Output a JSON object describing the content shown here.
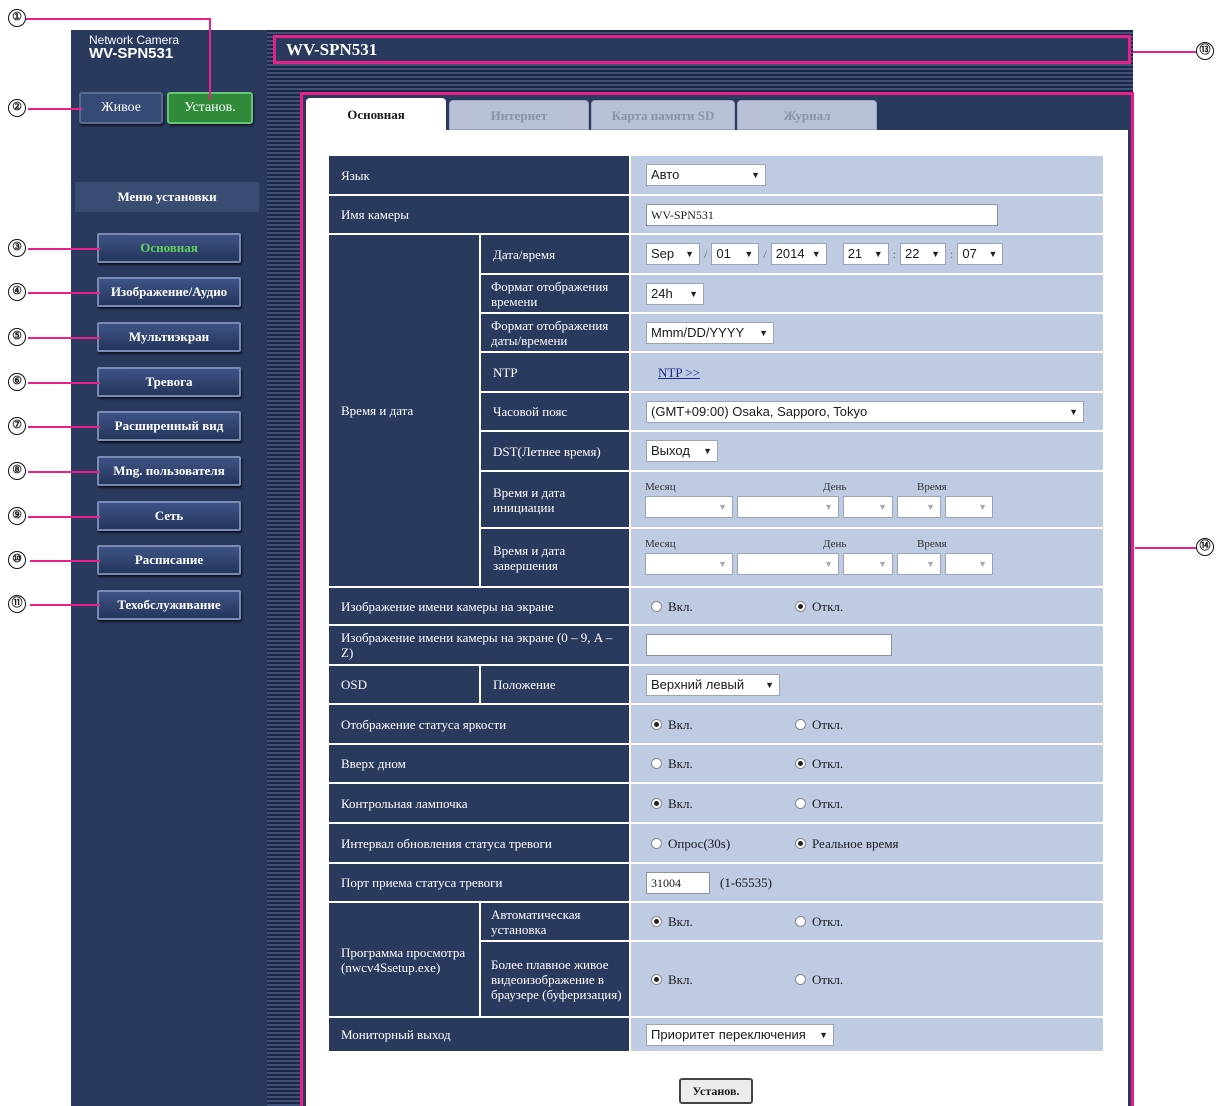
{
  "header": {
    "camera_label": "Network Camera",
    "camera_model": "WV-SPN531",
    "title": "WV-SPN531"
  },
  "top_buttons": {
    "live": "Живое",
    "setup": "Установ."
  },
  "menu": {
    "title": "Меню установки",
    "items": [
      "Основная",
      "Изображение/Аудио",
      "Мультиэкран",
      "Тревога",
      "Расширенный вид",
      "Mng. пользователя",
      "Сеть",
      "Расписание",
      "Техобслуживание"
    ]
  },
  "tabs": [
    "Основная",
    "Интернет",
    "Карта памяти SD",
    "Журнал"
  ],
  "form": {
    "language": {
      "label": "Язык",
      "value": "Авто"
    },
    "camera_name": {
      "label": "Имя камеры",
      "value": "WV-SPN531"
    },
    "time_date": {
      "group_label": "Время и дата",
      "datetime": {
        "label": "Дата/время",
        "month": "Sep",
        "day": "01",
        "year": "2014",
        "hour": "21",
        "minute": "22",
        "second": "07"
      },
      "time_format": {
        "label": "Формат отображения времени",
        "value": "24h"
      },
      "date_format": {
        "label": "Формат отображения даты/времени",
        "value": "Mmm/DD/YYYY"
      },
      "ntp": {
        "label": "NTP",
        "link": "NTP >>"
      },
      "timezone": {
        "label": "Часовой пояс",
        "value": "(GMT+09:00) Osaka, Sapporo, Tokyo"
      },
      "dst": {
        "label": "DST(Летнее время)",
        "value": "Выход"
      },
      "start": {
        "label": "Время и дата инициации"
      },
      "end": {
        "label": "Время и дата завершения"
      },
      "col_month": "Месяц",
      "col_day": "День",
      "col_time": "Время"
    },
    "camera_title_display": {
      "label": "Изображение имени камеры на экране",
      "on": "Вкл.",
      "off": "Откл."
    },
    "camera_title_text": {
      "label": "Изображение имени камеры на экране (0 – 9, A – Z)",
      "value": ""
    },
    "osd": {
      "label": "OSD",
      "sub_label": "Положение",
      "value": "Верхний левый"
    },
    "brightness_status": {
      "label": "Отображение статуса яркости",
      "on": "Вкл.",
      "off": "Откл."
    },
    "upside_down": {
      "label": "Вверх дном",
      "on": "Вкл.",
      "off": "Откл."
    },
    "indicator": {
      "label": "Контрольная лампочка",
      "on": "Вкл.",
      "off": "Откл."
    },
    "alarm_interval": {
      "label": "Интервал обновления статуса тревоги",
      "opt1": "Опрос(30s)",
      "opt2": "Реальное время"
    },
    "alarm_port": {
      "label": "Порт приема статуса тревоги",
      "value": "31004",
      "range": "(1-65535)"
    },
    "viewer": {
      "group_label": "Программа просмотра (nwcv4Ssetup.exe)",
      "auto_install": {
        "label": "Автоматическая установка",
        "on": "Вкл.",
        "off": "Откл."
      },
      "smoother": {
        "label": "Более плавное живое видеоизображение в браузере (буферизация)",
        "on": "Вкл.",
        "off": "Откл."
      }
    },
    "monitor_out": {
      "label": "Мониторный выход",
      "value": "Приоритет переключения"
    },
    "set_button": "Установ."
  },
  "callouts": [
    "①",
    "②",
    "③",
    "④",
    "⑤",
    "⑥",
    "⑦",
    "⑧",
    "⑨",
    "⑩",
    "⑪",
    "⑬",
    "⑭"
  ],
  "colors": {
    "callout_line": "#e91f8c",
    "active_menu_text": "#5ed35a",
    "panel_dark": "#2a3a5e",
    "value_bg": "#bfcae3"
  }
}
